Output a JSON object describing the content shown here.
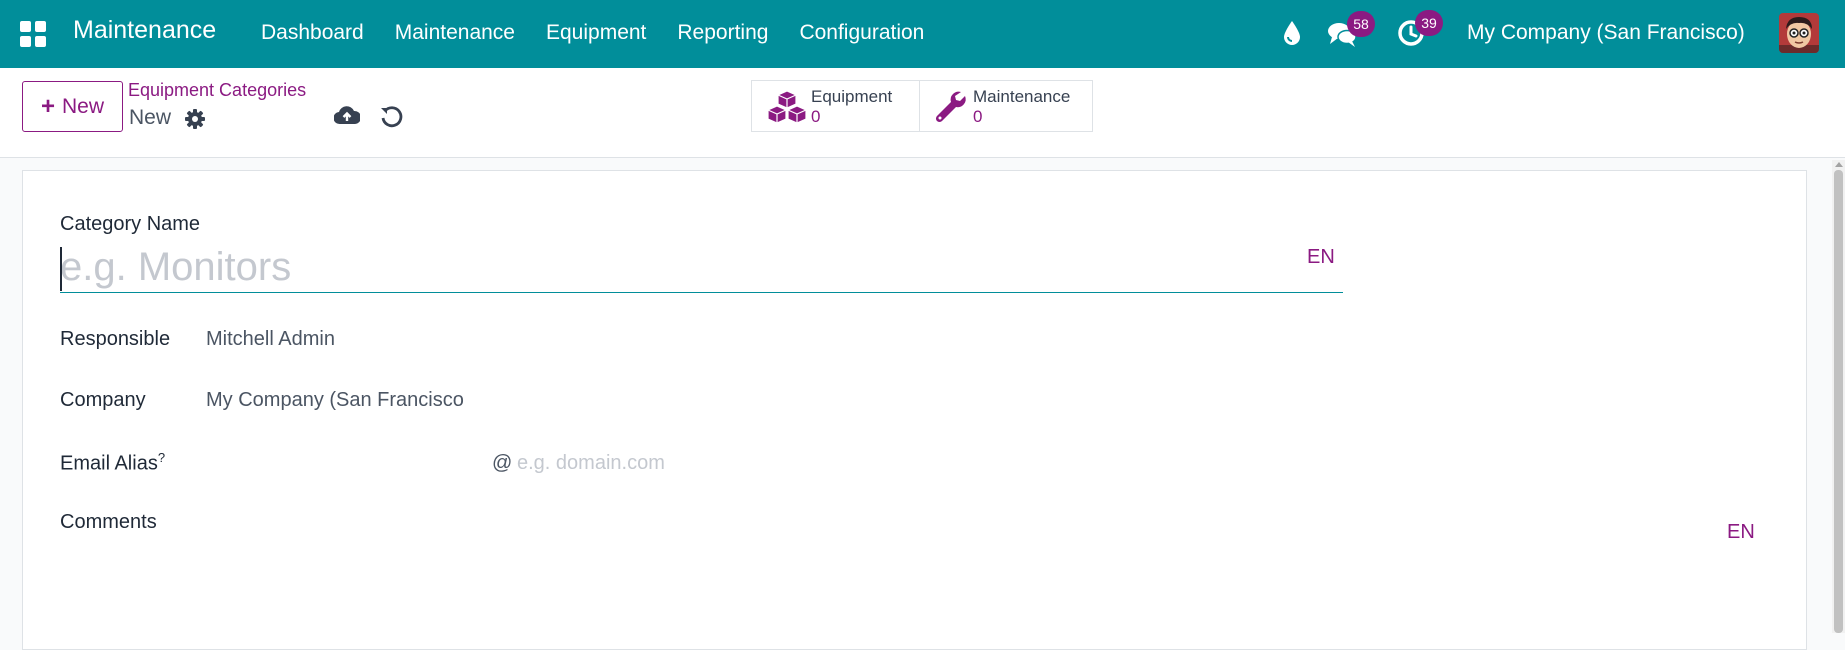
{
  "navbar": {
    "brand": "Maintenance",
    "menu": [
      "Dashboard",
      "Maintenance",
      "Equipment",
      "Reporting",
      "Configuration"
    ],
    "messages_count": "58",
    "activities_count": "39",
    "company": "My Company (San Francisco)",
    "icons": [
      "apps-icon",
      "drop-icon",
      "chat-icon",
      "clock-icon",
      "avatar"
    ]
  },
  "control_panel": {
    "new_label": "New",
    "breadcrumb": "Equipment Categories",
    "record_name": "New",
    "smart_buttons": [
      {
        "label": "Equipment",
        "value": "0",
        "icon": "cubes-icon"
      },
      {
        "label": "Maintenance",
        "value": "0",
        "icon": "wrench-icon"
      }
    ]
  },
  "form": {
    "name_label": "Category Name",
    "name_placeholder": "e.g. Monitors",
    "name_value": "",
    "lang": "EN",
    "responsible_label": "Responsible",
    "responsible_value": "Mitchell Admin",
    "company_label": "Company",
    "company_value": "My Company (San Francisco",
    "alias_label": "Email Alias",
    "alias_help": "?",
    "alias_at": "@",
    "alias_domain_placeholder": "e.g. domain.com",
    "comments_label": "Comments",
    "comments_lang": "EN"
  },
  "colors": {
    "navbar": "#018e9a",
    "accent": "#8b1a82",
    "text": "#374151"
  }
}
